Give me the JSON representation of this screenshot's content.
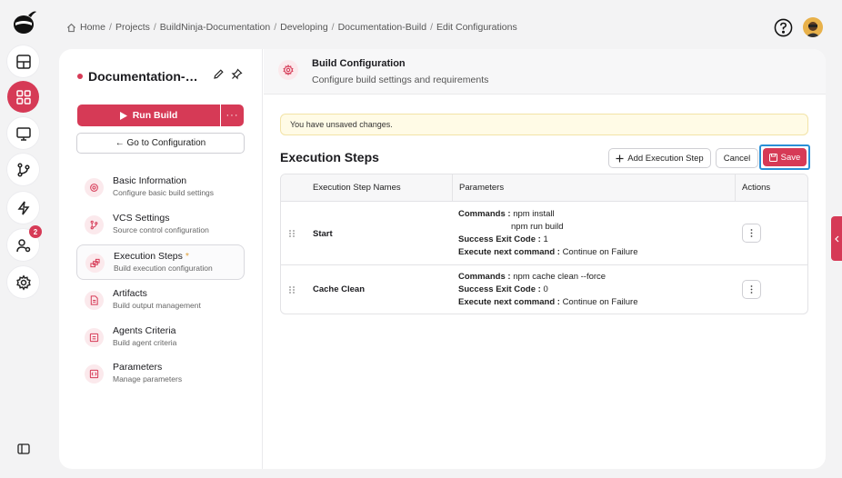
{
  "breadcrumb": [
    "Home",
    "Projects",
    "BuildNinja-Documentation",
    "Developing",
    "Documentation-Build",
    "Edit Configurations"
  ],
  "breadcrumb_sep": "/",
  "build": {
    "name": "Documentation-Build",
    "run_label": "Run Build",
    "more_label": "···",
    "goto_label": "← Go to Configuration",
    "status_color": "#d63a56"
  },
  "nav": [
    {
      "title": "Basic Information",
      "sub": "Configure basic build settings",
      "icon": "gear-icon"
    },
    {
      "title": "VCS Settings",
      "sub": "Source control configuration",
      "icon": "git-branch-icon"
    },
    {
      "title": "Execution Steps",
      "required": "*",
      "sub": "Build execution configuration",
      "icon": "steps-icon"
    },
    {
      "title": "Artifacts",
      "sub": "Build output management",
      "icon": "file-icon"
    },
    {
      "title": "Agents Criteria",
      "sub": "Build agent criteria",
      "icon": "agent-icon"
    },
    {
      "title": "Parameters",
      "sub": "Manage parameters",
      "icon": "parameters-icon"
    }
  ],
  "header": {
    "title": "Build Configuration",
    "subtitle": "Configure build settings and requirements"
  },
  "alert": "You have unsaved changes.",
  "steps": {
    "title": "Execution Steps",
    "add_label": "Add Execution Step",
    "cancel_label": "Cancel",
    "save_label": "Save",
    "columns": [
      "Execution Step Names",
      "Parameters",
      "Actions"
    ],
    "rows": [
      {
        "name": "Start",
        "commands_label": "Commands :",
        "commands": [
          "npm install",
          "npm run build"
        ],
        "exit_label": "Success Exit Code :",
        "exit_code": "1",
        "next_label": "Execute next command :",
        "next": "Continue on Failure"
      },
      {
        "name": "Cache Clean",
        "commands_label": "Commands :",
        "commands": [
          "npm cache clean --force"
        ],
        "exit_label": "Success Exit Code :",
        "exit_code": "0",
        "next_label": "Execute next command :",
        "next": "Continue on Failure"
      }
    ]
  },
  "rail": {
    "notification_count": "2"
  },
  "colors": {
    "accent": "#d63a56",
    "focus": "#2a8fd6",
    "warning_bg": "#fffbe6"
  }
}
